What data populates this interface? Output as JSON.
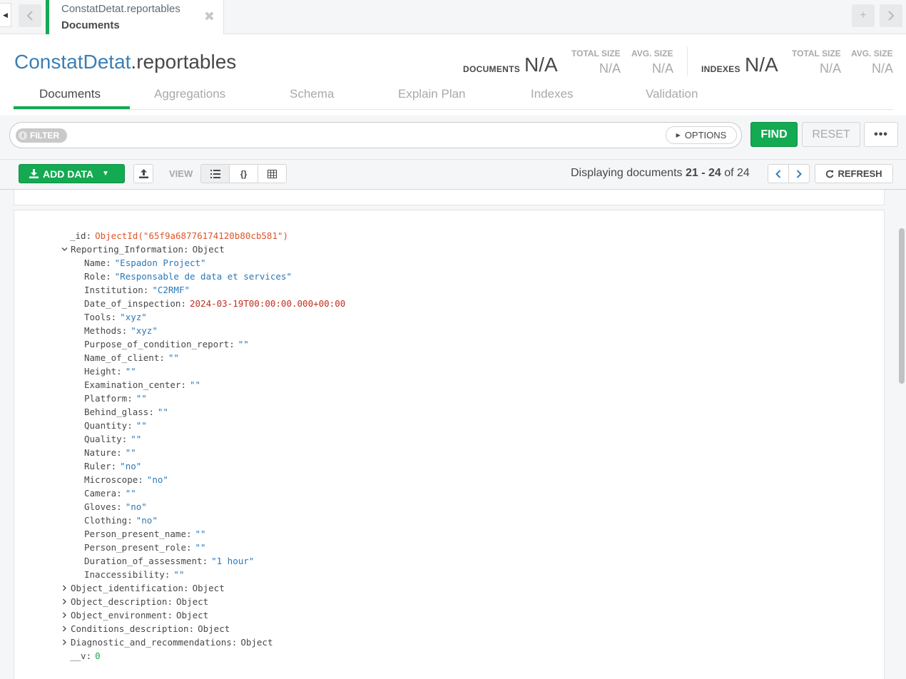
{
  "tab": {
    "line1": "ConstatDetat.reportables",
    "line2": "Documents",
    "close": "✖"
  },
  "header": {
    "db_name": "ConstatDetat",
    "coll_name": ".reportables",
    "documents_label": "DOCUMENTS",
    "documents_value": "N/A",
    "doc_total_size_label": "TOTAL SIZE",
    "doc_total_size_value": "N/A",
    "doc_avg_size_label": "AVG. SIZE",
    "doc_avg_size_value": "N/A",
    "indexes_label": "INDEXES",
    "indexes_value": "N/A",
    "idx_total_size_label": "TOTAL SIZE",
    "idx_total_size_value": "N/A",
    "idx_avg_size_label": "AVG. SIZE",
    "idx_avg_size_value": "N/A"
  },
  "subtabs": [
    "Documents",
    "Aggregations",
    "Schema",
    "Explain Plan",
    "Indexes",
    "Validation"
  ],
  "filter": {
    "pill_label": "FILTER",
    "options_label": "OPTIONS",
    "find_label": "FIND",
    "reset_label": "RESET",
    "more_label": "•••"
  },
  "actions": {
    "add_data_label": "ADD DATA",
    "view_label": "VIEW",
    "paging_prefix": "Displaying documents ",
    "paging_range": "21 - 24",
    "paging_suffix": " of 24",
    "refresh_label": "REFRESH"
  },
  "document": {
    "id_key": "_id",
    "id_value": "ObjectId(\"65f9a68776174120b80cb581\")",
    "reporting_key": "Reporting_Information",
    "reporting_type": "Object",
    "fields": [
      {
        "key": "Name",
        "value": "\"Espadon Project\"",
        "kind": "s"
      },
      {
        "key": "Role",
        "value": "\"Responsable de data et services\"",
        "kind": "s"
      },
      {
        "key": "Institution",
        "value": "\"C2RMF\"",
        "kind": "s"
      },
      {
        "key": "Date_of_inspection",
        "value": "2024-03-19T00:00:00.000+00:00",
        "kind": "dt"
      },
      {
        "key": "Tools",
        "value": "\"xyz\"",
        "kind": "s"
      },
      {
        "key": "Methods",
        "value": "\"xyz\"",
        "kind": "s"
      },
      {
        "key": "Purpose_of_condition_report",
        "value": "\"\"",
        "kind": "s"
      },
      {
        "key": "Name_of_client",
        "value": "\"\"",
        "kind": "s"
      },
      {
        "key": "Height",
        "value": "\"\"",
        "kind": "s"
      },
      {
        "key": "Examination_center",
        "value": "\"\"",
        "kind": "s"
      },
      {
        "key": "Platform",
        "value": "\"\"",
        "kind": "s"
      },
      {
        "key": "Behind_glass",
        "value": "\"\"",
        "kind": "s"
      },
      {
        "key": "Quantity",
        "value": "\"\"",
        "kind": "s"
      },
      {
        "key": "Quality",
        "value": "\"\"",
        "kind": "s"
      },
      {
        "key": "Nature",
        "value": "\"\"",
        "kind": "s"
      },
      {
        "key": "Ruler",
        "value": "\"no\"",
        "kind": "s"
      },
      {
        "key": "Microscope",
        "value": "\"no\"",
        "kind": "s"
      },
      {
        "key": "Camera",
        "value": "\"\"",
        "kind": "s"
      },
      {
        "key": "Gloves",
        "value": "\"no\"",
        "kind": "s"
      },
      {
        "key": "Clothing",
        "value": "\"no\"",
        "kind": "s"
      },
      {
        "key": "Person_present_name",
        "value": "\"\"",
        "kind": "s"
      },
      {
        "key": "Person_present_role",
        "value": "\"\"",
        "kind": "s"
      },
      {
        "key": "Duration_of_assessment",
        "value": "\"1 hour\"",
        "kind": "s"
      },
      {
        "key": "Inaccessibility",
        "value": "\"\"",
        "kind": "s"
      }
    ],
    "collapsed": [
      {
        "key": "Object_identification",
        "value": "Object"
      },
      {
        "key": "Object_description",
        "value": "Object"
      },
      {
        "key": "Object_environment",
        "value": "Object"
      },
      {
        "key": "Conditions_description",
        "value": "Object"
      },
      {
        "key": "Diagnostic_and_recommendations",
        "value": "Object"
      }
    ],
    "v_key": "__v",
    "v_value": "0"
  },
  "colors": {
    "accent_green": "#13aa52",
    "link_blue": "#3a7fb5",
    "string_blue": "#2b78b8",
    "objectid_orange": "#e0542c",
    "date_red": "#c22d1c"
  }
}
